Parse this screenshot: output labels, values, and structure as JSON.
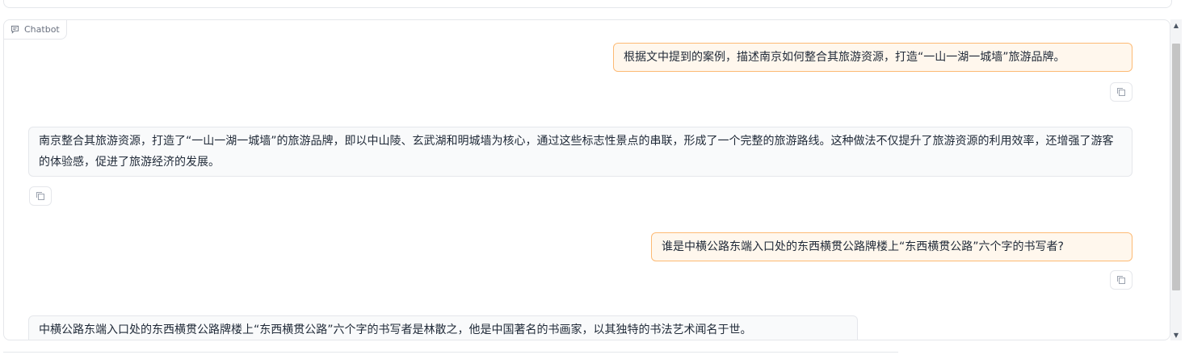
{
  "panel": {
    "label": "Chatbot",
    "label_icon": "chat-bubble-icon"
  },
  "messages": [
    {
      "role": "user",
      "text": "根据文中提到的案例，描述南京如何整合其旅游资源，打造“一山一湖一城墙”旅游品牌。"
    },
    {
      "role": "bot",
      "text": "南京整合其旅游资源，打造了“一山一湖一城墙”的旅游品牌，即以中山陵、玄武湖和明城墙为核心，通过这些标志性景点的串联，形成了一个完整的旅游路线。这种做法不仅提升了旅游资源的利用效率，还增强了游客的体验感，促进了旅游经济的发展。"
    },
    {
      "role": "user",
      "text": "谁是中横公路东端入口处的东西横贯公路牌楼上“东西横贯公路”六个字的书写者?"
    },
    {
      "role": "bot",
      "text": "中横公路东端入口处的东西横贯公路牌楼上“东西横贯公路”六个字的书写者是林散之，他是中国著名的书画家，以其独特的书法艺术闻名于世。"
    }
  ],
  "icons": {
    "copy": "copy-icon",
    "scroll_up": "scroll-up-arrow",
    "scroll_down": "scroll-down-arrow"
  },
  "colors": {
    "user_bubble_bg": "#fff7ed",
    "user_bubble_border": "#fdba74",
    "bot_bubble_bg": "#f9fafb",
    "border": "#e5e7eb"
  }
}
